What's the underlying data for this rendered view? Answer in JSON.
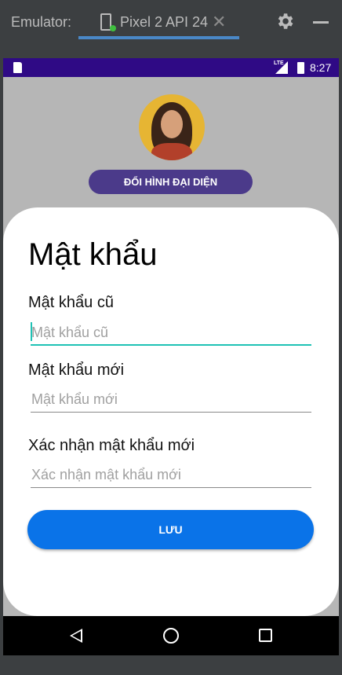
{
  "emulator": {
    "label": "Emulator:",
    "tab_label": "Pixel 2 API 24",
    "close_glyph": "✕"
  },
  "status_bar": {
    "network": "LTE",
    "time": "8:27"
  },
  "profile": {
    "change_avatar_label": "ĐỔI HÌNH ĐẠI DIỆN"
  },
  "form": {
    "title": "Mật khẩu",
    "old_password": {
      "label": "Mật khẩu cũ",
      "placeholder": "Mật khẩu cũ",
      "value": ""
    },
    "new_password": {
      "label": "Mật khẩu mới",
      "placeholder": "Mật khẩu mới",
      "value": ""
    },
    "confirm_password": {
      "label": "Xác nhận mật khẩu mới",
      "placeholder": "Xác nhận mật khẩu mới",
      "value": ""
    },
    "save_label": "LƯU"
  },
  "colors": {
    "status_bar": "#2f0a85",
    "avatar_button": "#4b3a8a",
    "focus_accent": "#1fc2b5",
    "save_button": "#0a73e8"
  }
}
